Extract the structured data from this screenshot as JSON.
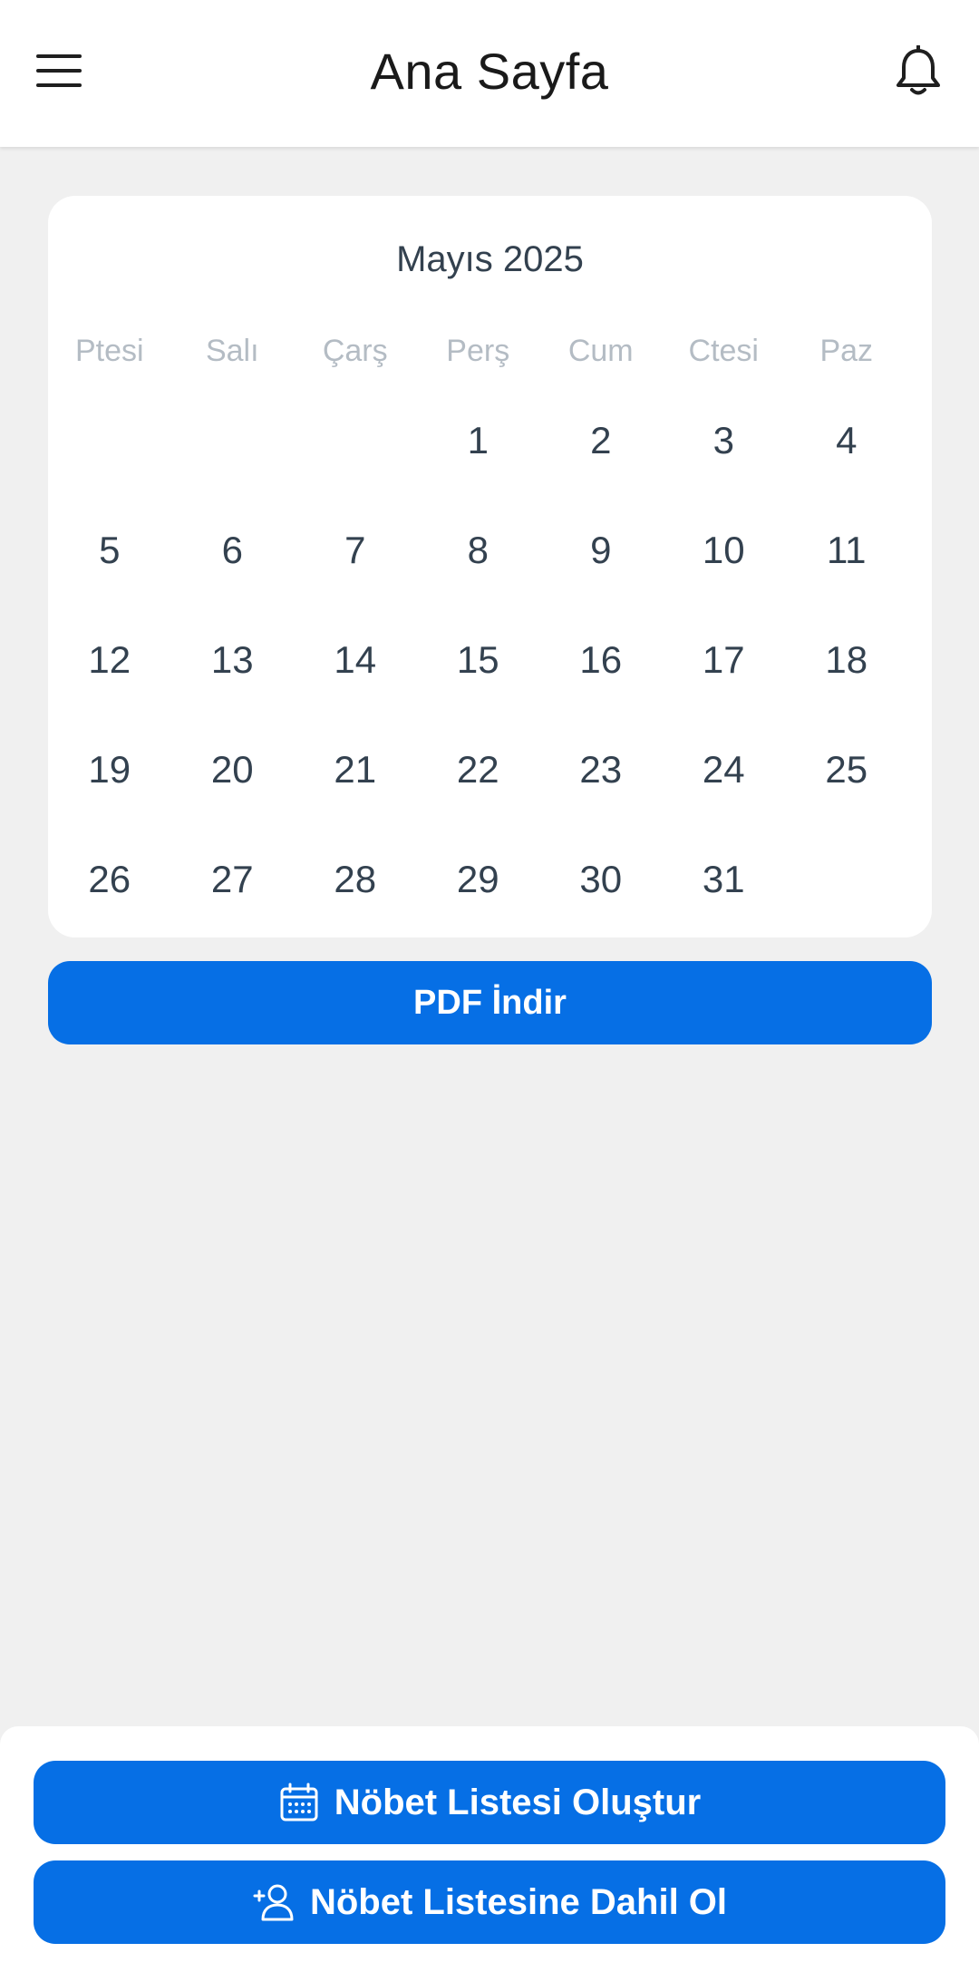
{
  "header": {
    "title": "Ana Sayfa",
    "menu_icon": "hamburger-menu-icon",
    "notification_icon": "bell-icon"
  },
  "calendar": {
    "month_label": "Mayıs 2025",
    "weekdays": [
      "Ptesi",
      "Salı",
      "Çarş",
      "Perş",
      "Cum",
      "Ctesi",
      "Paz"
    ],
    "weeks": [
      [
        "",
        "",
        "",
        "1",
        "2",
        "3",
        "4"
      ],
      [
        "5",
        "6",
        "7",
        "8",
        "9",
        "10",
        "11"
      ],
      [
        "12",
        "13",
        "14",
        "15",
        "16",
        "17",
        "18"
      ],
      [
        "19",
        "20",
        "21",
        "22",
        "23",
        "24",
        "25"
      ],
      [
        "26",
        "27",
        "28",
        "29",
        "30",
        "31",
        ""
      ]
    ]
  },
  "pdf_button": {
    "label": "PDF İndir"
  },
  "actions": {
    "create_list": {
      "label": "Nöbet Listesi Oluştur",
      "icon": "calendar-icon"
    },
    "join_list": {
      "label": "Nöbet Listesine Dahil Ol",
      "icon": "user-plus-icon"
    }
  },
  "colors": {
    "primary": "#066fe5",
    "background": "#f0f0f0",
    "card": "#ffffff",
    "weekday_text": "#b4bcc4",
    "day_text": "#33414f"
  }
}
